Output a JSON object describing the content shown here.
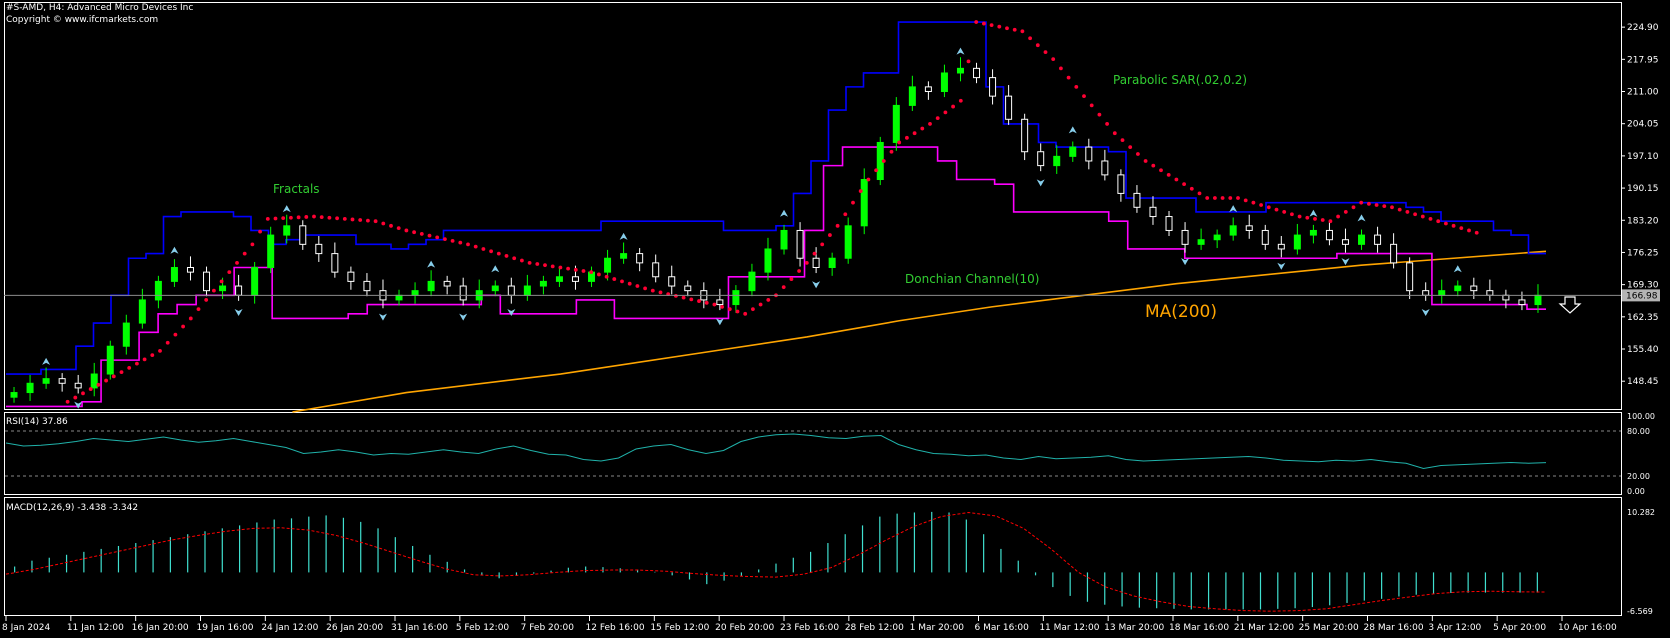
{
  "header": {
    "symbol_line": "#S-AMD, H4:  Advanced Micro Devices Inc",
    "copyright": "Copyright © www.ifcmarkets.com"
  },
  "labels": {
    "fractals": "Fractals",
    "sar": "Parabolic SAR(.02,0.2)",
    "donchian": "Donchian Channel(10)",
    "ma": "MA(200)",
    "rsi": "RSI(14) 37.86",
    "macd": "MACD(12,26,9) -3.438 -3.342"
  },
  "colors": {
    "background": "#000000",
    "axis": "#ffffff",
    "bull_candle": "#00ff00",
    "bear_candle": "#ffffff",
    "donchian_upper": "#0000ff",
    "donchian_lower": "#ff00ff",
    "sar": "#ff0033",
    "ma": "#ffa500",
    "rsi": "#20b2aa",
    "macd_hist": "#40e0d0",
    "macd_signal": "#ff0000",
    "fractal": "#87ceeb",
    "annotation": "#32cd32",
    "price_marker": "#b0b0b0"
  },
  "icons": {
    "signal": "down-arrow-icon"
  },
  "chart_data": [
    {
      "type": "candlestick",
      "panel": "price",
      "x_ticks": [
        "8 Jan 2024",
        "11 Jan 12:00",
        "16 Jan 20:00",
        "19 Jan 16:00",
        "24 Jan 12:00",
        "26 Jan 20:00",
        "31 Jan 16:00",
        "5 Feb 12:00",
        "7 Feb 20:00",
        "12 Feb 16:00",
        "15 Feb 12:00",
        "20 Feb 20:00",
        "23 Feb 16:00",
        "28 Feb 12:00",
        "1 Mar 20:00",
        "6 Mar 16:00",
        "11 Mar 12:00",
        "13 Mar 20:00",
        "18 Mar 16:00",
        "21 Mar 12:00",
        "25 Mar 20:00",
        "28 Mar 16:00",
        "3 Apr 12:00",
        "5 Apr 20:00",
        "10 Apr 16:00"
      ],
      "y_ticks": [
        "224.90",
        "217.95",
        "211.00",
        "204.05",
        "197.10",
        "190.15",
        "183.20",
        "176.25",
        "169.30",
        "162.35",
        "155.40",
        "148.45"
      ],
      "ylim": [
        141.8,
        228.6
      ],
      "current_price": "166.98",
      "close": [
        146,
        148,
        149,
        148,
        147,
        150,
        156,
        161,
        166,
        170,
        173,
        172,
        168,
        169,
        167,
        173,
        180,
        182,
        178,
        176,
        172,
        170,
        168,
        166,
        167,
        168,
        170,
        169,
        166,
        168,
        169,
        167,
        169,
        170,
        171,
        170,
        172,
        175,
        176,
        174,
        171,
        169,
        168,
        166,
        165,
        168,
        172,
        177,
        181,
        175,
        173,
        175,
        182,
        192,
        200,
        208,
        212,
        211,
        215,
        216,
        214,
        210,
        205,
        198,
        195,
        197,
        199,
        196,
        193,
        189,
        186,
        184,
        181,
        178,
        179,
        180,
        182,
        181,
        178,
        177,
        180,
        181,
        179,
        178,
        180,
        178,
        174,
        168,
        167,
        168,
        169,
        168,
        167,
        166,
        165,
        167
      ],
      "donchian_upper": [
        150,
        150,
        151,
        151,
        156,
        161,
        167,
        175,
        176,
        184,
        185,
        185,
        185,
        184,
        181,
        178,
        179,
        180,
        180,
        180,
        178,
        178,
        177,
        178,
        179,
        181,
        181,
        181,
        181,
        181,
        181,
        181,
        181,
        181,
        183,
        183,
        183,
        183,
        183,
        183,
        183,
        181,
        181,
        181,
        182,
        189,
        196,
        207,
        212,
        215,
        215,
        226,
        226,
        226,
        226,
        226,
        212,
        204,
        204,
        200,
        199,
        199,
        199,
        198,
        188,
        188,
        188,
        188,
        185,
        185,
        185,
        185,
        187,
        187,
        187,
        187,
        187,
        187,
        187,
        187,
        186,
        185,
        183,
        183,
        183,
        181,
        180,
        176
      ],
      "donchian_lower": [
        143,
        143,
        143,
        143,
        144,
        153,
        153,
        159,
        163,
        165,
        167,
        167,
        173,
        173,
        162,
        162,
        162,
        162,
        163,
        165,
        165,
        165,
        165,
        165,
        165,
        167,
        163,
        163,
        163,
        163,
        166,
        166,
        162,
        162,
        162,
        162,
        162,
        162,
        171,
        171,
        171,
        171,
        181,
        195,
        199,
        199,
        199,
        199,
        199,
        196,
        192,
        192,
        191,
        185,
        185,
        185,
        185,
        185,
        183,
        177,
        177,
        177,
        175,
        175,
        175,
        175,
        175,
        175,
        175,
        175,
        176,
        176,
        176,
        176,
        176,
        165,
        165,
        165,
        165,
        165,
        164
      ],
      "ma200": [
        [
          18.6,
          141.8
        ],
        [
          26,
          146
        ],
        [
          36,
          150
        ],
        [
          46,
          155
        ],
        [
          52,
          158
        ],
        [
          58,
          161.5
        ],
        [
          64,
          164.5
        ],
        [
          70,
          167
        ],
        [
          76,
          169.5
        ],
        [
          82,
          171.5
        ],
        [
          88,
          173.5
        ],
        [
          94,
          175
        ],
        [
          100,
          176.5
        ]
      ],
      "sar": [
        [
          4,
          144
        ],
        [
          10,
          155
        ],
        [
          12,
          162
        ],
        [
          14,
          170
        ],
        [
          16,
          178
        ],
        [
          17,
          183.5
        ],
        [
          20,
          184
        ],
        [
          24,
          183
        ],
        [
          26,
          181
        ],
        [
          30,
          178
        ],
        [
          34,
          174
        ],
        [
          38,
          172
        ],
        [
          42,
          168
        ],
        [
          46,
          165
        ],
        [
          48,
          163
        ],
        [
          50,
          167
        ],
        [
          52,
          174
        ],
        [
          54,
          182
        ],
        [
          56,
          192
        ],
        [
          58,
          200
        ],
        [
          60,
          204
        ],
        [
          62,
          209
        ],
        [
          63,
          226
        ],
        [
          66,
          224
        ],
        [
          68,
          218
        ],
        [
          70,
          210
        ],
        [
          72,
          202
        ],
        [
          74,
          196
        ],
        [
          76,
          192
        ],
        [
          78,
          188
        ],
        [
          80,
          188
        ],
        [
          82,
          186
        ],
        [
          84,
          184
        ],
        [
          86,
          183
        ],
        [
          88,
          187
        ],
        [
          90,
          186
        ],
        [
          92,
          184
        ],
        [
          94,
          182
        ],
        [
          96,
          180
        ]
      ]
    },
    {
      "type": "line",
      "panel": "rsi",
      "y_ticks": [
        "100.00",
        "80.00",
        "20.00",
        "0.00"
      ],
      "levels": [
        80,
        20
      ],
      "values": [
        64,
        60,
        61,
        63,
        66,
        70,
        68,
        66,
        69,
        72,
        68,
        65,
        67,
        70,
        66,
        62,
        58,
        50,
        52,
        55,
        52,
        48,
        50,
        49,
        52,
        55,
        52,
        50,
        56,
        60,
        54,
        49,
        48,
        42,
        40,
        44,
        56,
        60,
        62,
        55,
        50,
        54,
        66,
        72,
        75,
        76,
        74,
        71,
        70,
        73,
        74,
        62,
        55,
        50,
        49,
        47,
        48,
        44,
        42,
        46,
        43,
        44,
        45,
        47,
        42,
        40,
        41,
        42,
        43,
        44,
        45,
        46,
        44,
        41,
        40,
        39,
        41,
        40,
        42,
        39,
        37,
        30,
        34,
        35,
        36,
        37,
        38,
        37,
        37.86
      ]
    },
    {
      "type": "histogram+line",
      "panel": "macd",
      "y_ticks": [
        "10.282",
        "-6.569"
      ],
      "histogram": [
        1,
        2,
        2.5,
        3,
        3.5,
        4,
        4.5,
        5,
        5.5,
        6,
        6.5,
        7,
        7.5,
        8,
        8.5,
        9,
        9.2,
        9.5,
        9.7,
        9.3,
        8.6,
        7.5,
        6,
        4.5,
        3,
        1.8,
        0.5,
        -0.5,
        -1,
        -0.6,
        -0.2,
        0.3,
        0.8,
        1,
        0.9,
        0.7,
        0.5,
        0.1,
        -0.5,
        -1.2,
        -2,
        -1.4,
        -0.6,
        0.5,
        1.5,
        2.5,
        3.5,
        5,
        6.5,
        8,
        9.5,
        10,
        10.2,
        10.3,
        10.2,
        9,
        6.5,
        4,
        2,
        -0.5,
        -2.5,
        -4,
        -5,
        -5.5,
        -5.8,
        -6,
        -6.1,
        -6.2,
        -6.3,
        -6.3,
        -6.3,
        -6.3,
        -6.3,
        -6.2,
        -6.1,
        -5.9,
        -5.6,
        -5.2,
        -4.8,
        -4.5,
        -4.1,
        -3.8,
        -3.6,
        -3.5,
        -3.45,
        -3.44,
        -3.44,
        -3.44,
        -3.438
      ],
      "signal": [
        -0.3,
        0.5,
        1.5,
        2.5,
        3.5,
        4.5,
        5.5,
        6.3,
        7,
        7.5,
        7.6,
        7.2,
        6.3,
        5,
        3.5,
        2,
        0.6,
        -0.4,
        -0.6,
        -0.4,
        0,
        0.3,
        0.4,
        0.4,
        0.2,
        -0.2,
        -0.5,
        -0.7,
        -0.8,
        -0.3,
        0.8,
        3,
        5.5,
        7.8,
        9.5,
        10.2,
        9.6,
        7.5,
        4,
        0,
        -2.5,
        -4,
        -5,
        -5.8,
        -6.2,
        -6.5,
        -6.6,
        -6.5,
        -6.2,
        -5.5,
        -4.8,
        -4.2,
        -3.6,
        -3.3,
        -3.2,
        -3.3,
        -3.342
      ]
    }
  ]
}
